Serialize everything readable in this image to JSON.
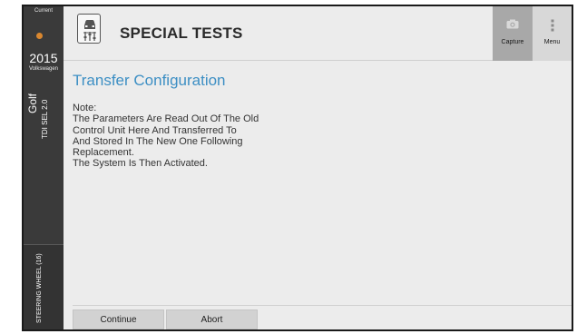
{
  "sidebar": {
    "current_label": "Current",
    "year": "2015",
    "make": "Volkswagen",
    "model": "Golf",
    "trim": "TDI SEL 2.0",
    "module": "STEERING WHEEL (16)"
  },
  "header": {
    "title": "SPECIAL TESTS",
    "capture_label": "Capture",
    "menu_label": "Menu"
  },
  "main": {
    "section_title": "Transfer Configuration",
    "note_lines": [
      "Note:",
      "The Parameters Are Read Out Of The Old",
      "Control Unit Here And Transferred To",
      "And Stored In The New One Following",
      "Replacement.",
      "The System Is Then Activated."
    ]
  },
  "footer": {
    "continue_label": "Continue",
    "abort_label": "Abort"
  },
  "colors": {
    "accent": "#3d8fc4",
    "sidebar_bg": "#3a3a3a",
    "indicator": "#d9872f"
  },
  "icons": [
    "car-settings-icon",
    "camera-icon",
    "menu-dots-icon"
  ]
}
